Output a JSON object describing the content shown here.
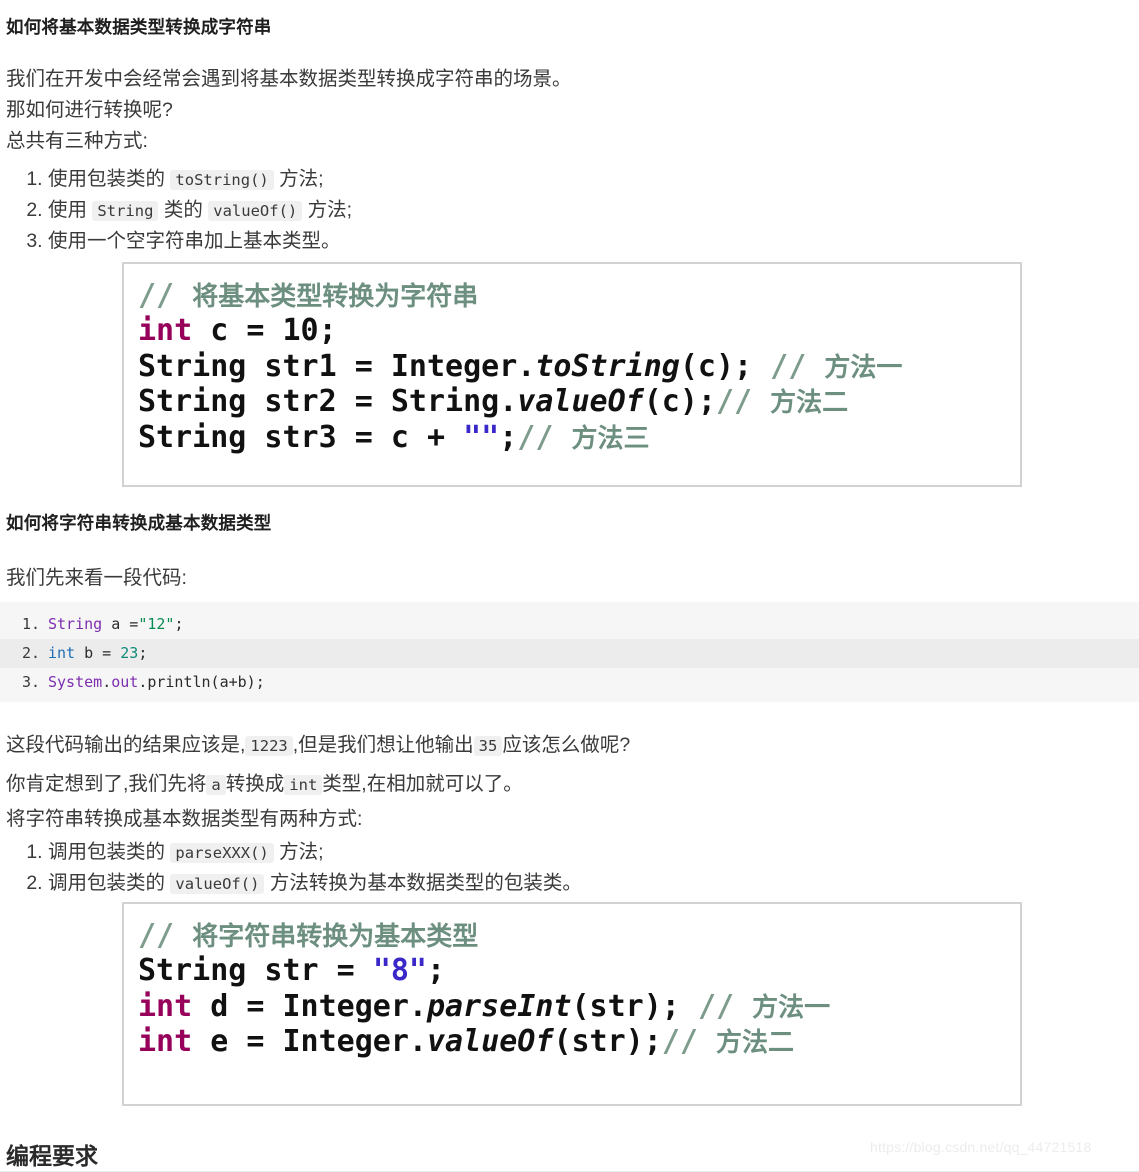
{
  "document": {
    "sections": [
      {
        "heading": "如何将基本数据类型转换成字符串",
        "paragraphs": [
          "我们在开发中会经常会遇到将基本数据类型转换成字符串的场景。",
          "那如何进行转换呢?",
          "总共有三种方式:"
        ]
      }
    ],
    "list_one": [
      {
        "pre": "使用包装类的 ",
        "code": "toString()",
        "post": " 方法;"
      },
      {
        "pre": "使用 ",
        "code": "String",
        "mid": " 类的 ",
        "code2": "valueOf()",
        "post": " 方法;"
      },
      {
        "pre": "使用一个空字符串加上基本类型。",
        "code": "",
        "post": ""
      }
    ],
    "code_image_1": {
      "comment_slashes": "// ",
      "comment_text": "将基本类型转换为字符串",
      "line2_kw": "int",
      "line2_rest": " c = 10;",
      "line3_a": "String str1 = Integer.",
      "line3_ital": "toString",
      "line3_b": "(c); ",
      "line3_cmt": "// ",
      "line3_cmt_cn": "方法一",
      "line4_a": "String str2 = String.",
      "line4_ital": "valueOf",
      "line4_b": "(c);",
      "line4_cmt": "// ",
      "line4_cmt_cn": "方法二",
      "line5_a": "String str3 = c + ",
      "line5_str": "\"\"",
      "line5_b": ";",
      "line5_cmt": "// ",
      "line5_cmt_cn": "方法三"
    },
    "section2": {
      "heading": "如何将字符串转换成基本数据类型",
      "intro": "我们先来看一段代码:"
    },
    "code_block": {
      "lines": [
        {
          "num": "1.",
          "type": "String",
          "space1": " a =",
          "str": "\"12\"",
          "end": ";"
        },
        {
          "num": "2.",
          "type": "int",
          "space1": " b = ",
          "num_val": "23",
          "end": ";"
        },
        {
          "num": "3.",
          "pkg": "System",
          "dot1": ".",
          "pkg2": "out",
          "dot2": ".",
          "call": "println(a+b);"
        }
      ]
    },
    "after_code": {
      "line1_a": "这段代码输出的结果应该是,",
      "line1_code1": "1223",
      "line1_b": ",但是我们想让他输出",
      "line1_code2": "35",
      "line1_c": "应该怎么做呢?",
      "line2_a": "你肯定想到了,我们先将",
      "line2_code1": "a",
      "line2_b": "转换成",
      "line2_code2": "int",
      "line2_c": "类型,在相加就可以了。",
      "line3": "将字符串转换成基本数据类型有两种方式:"
    },
    "list_two": [
      {
        "pre": "调用包装类的 ",
        "code": "parseXXX()",
        "post": " 方法;"
      },
      {
        "pre": "调用包装类的 ",
        "code": "valueOf()",
        "post": " 方法转换为基本数据类型的包装类。"
      }
    ],
    "code_image_2": {
      "comment_slashes": "// ",
      "comment_text": "将字符串转换为基本类型",
      "line2_a": "String str = ",
      "line2_str": "\"8\"",
      "line2_b": ";",
      "line3_kw": "int",
      "line3_a": " d = Integer.",
      "line3_ital": "parseInt",
      "line3_b": "(str); ",
      "line3_cmt": "// ",
      "line3_cmt_cn": "方法一",
      "line4_kw": "int",
      "line4_a": " e = Integer.",
      "line4_ital": "valueOf",
      "line4_b": "(str);",
      "line4_cmt": "// ",
      "line4_cmt_cn": "方法二"
    },
    "footer_heading": "编程要求",
    "watermark": "https://blog.csdn.net/qq_44721518"
  },
  "colors": {
    "text": "#3a3a3a",
    "heading": "#1f1f1f",
    "inline_code_bg": "#f0f0f0",
    "codeblock_bg": "#f6f6f6",
    "codeblock_alt": "#ececec",
    "image_border": "#d2d2d2",
    "comment_green": "#7e9c8c",
    "keyword_magenta": "#96005a",
    "string_blue": "#3a28c8",
    "watermark": "#ececed"
  }
}
